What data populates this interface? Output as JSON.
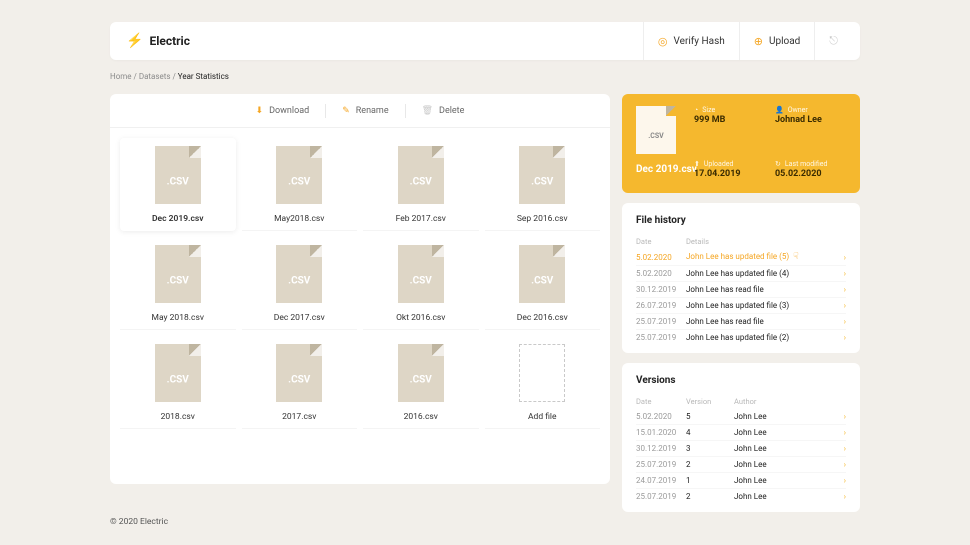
{
  "header": {
    "app_name": "Electric",
    "verify_label": "Verify Hash",
    "upload_label": "Upload"
  },
  "breadcrumb": {
    "items": [
      "Home",
      "Datasets",
      "Year Statistics"
    ]
  },
  "toolbar": {
    "download_label": "Download",
    "rename_label": "Rename",
    "delete_label": "Delete"
  },
  "files": [
    {
      "name": "Dec 2019.csv",
      "selected": true
    },
    {
      "name": "May2018.csv"
    },
    {
      "name": "Feb 2017.csv"
    },
    {
      "name": "Sep 2016.csv"
    },
    {
      "name": "May 2018.csv"
    },
    {
      "name": "Dec 2017.csv"
    },
    {
      "name": "Okt 2016.csv"
    },
    {
      "name": "Dec 2016.csv"
    },
    {
      "name": "2018.csv"
    },
    {
      "name": "2017.csv"
    },
    {
      "name": "2016.csv"
    },
    {
      "name": "Add file",
      "add": true
    }
  ],
  "meta": {
    "size_label": "Size",
    "size_value": "999 MB",
    "owner_label": "Owner",
    "owner_value": "Johnad Lee",
    "uploaded_label": "Uploaded",
    "uploaded_value": "17.04.2019",
    "lastmod_label": "Last modified",
    "lastmod_value": "05.02.2020",
    "file_name": "Dec 2019.csv"
  },
  "history": {
    "title": "File history",
    "th_date": "Date",
    "th_details": "Details",
    "rows": [
      {
        "date": "5.02.2020",
        "details": "John Lee has updated file (5)",
        "hl": true
      },
      {
        "date": "5.02.2020",
        "details": "John Lee has updated file (4)"
      },
      {
        "date": "30.12.2019",
        "details": "John Lee has read file"
      },
      {
        "date": "26.07.2019",
        "details": "John Lee has updated file (3)"
      },
      {
        "date": "25.07.2019",
        "details": "John Lee has read file"
      },
      {
        "date": "25.07.2019",
        "details": "John Lee has updated file (2)"
      }
    ]
  },
  "versions": {
    "title": "Versions",
    "th_date": "Date",
    "th_version": "Version",
    "th_author": "Author",
    "rows": [
      {
        "date": "5.02.2020",
        "version": "5",
        "author": "John Lee"
      },
      {
        "date": "15.01.2020",
        "version": "4",
        "author": "John Lee"
      },
      {
        "date": "30.12.2019",
        "version": "3",
        "author": "John Lee"
      },
      {
        "date": "25.07.2019",
        "version": "2",
        "author": "John Lee"
      },
      {
        "date": "24.07.2019",
        "version": "1",
        "author": "John Lee"
      },
      {
        "date": "25.07.2019",
        "version": "2",
        "author": "John Lee"
      }
    ]
  },
  "footer": {
    "copyright": "© 2020 Electric"
  }
}
